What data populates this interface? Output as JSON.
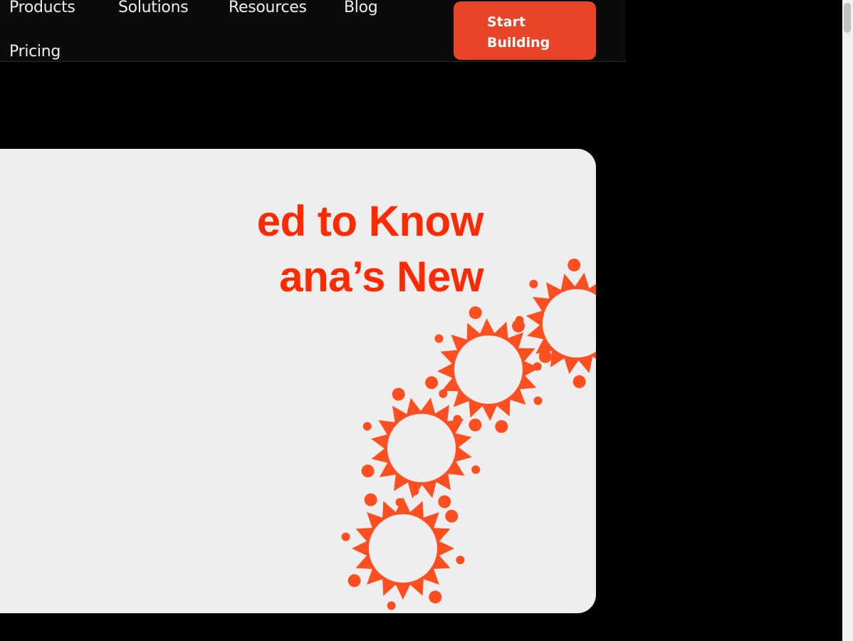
{
  "nav": {
    "products": "Products",
    "solutions": "Solutions",
    "resources": "Resources",
    "blog": "Blog",
    "pricing": "Pricing",
    "cta_label": "Start Building"
  },
  "hero": {
    "headline_line1": "ed to Know",
    "headline_line2": "ana’s New"
  },
  "decor": {
    "pattern_icon": "sun-ring-pattern-icon",
    "accent_color": "#e84427",
    "headline_color": "#ff2a00",
    "pattern_color": "#ff4e1f",
    "card_color": "#eeeeee"
  }
}
